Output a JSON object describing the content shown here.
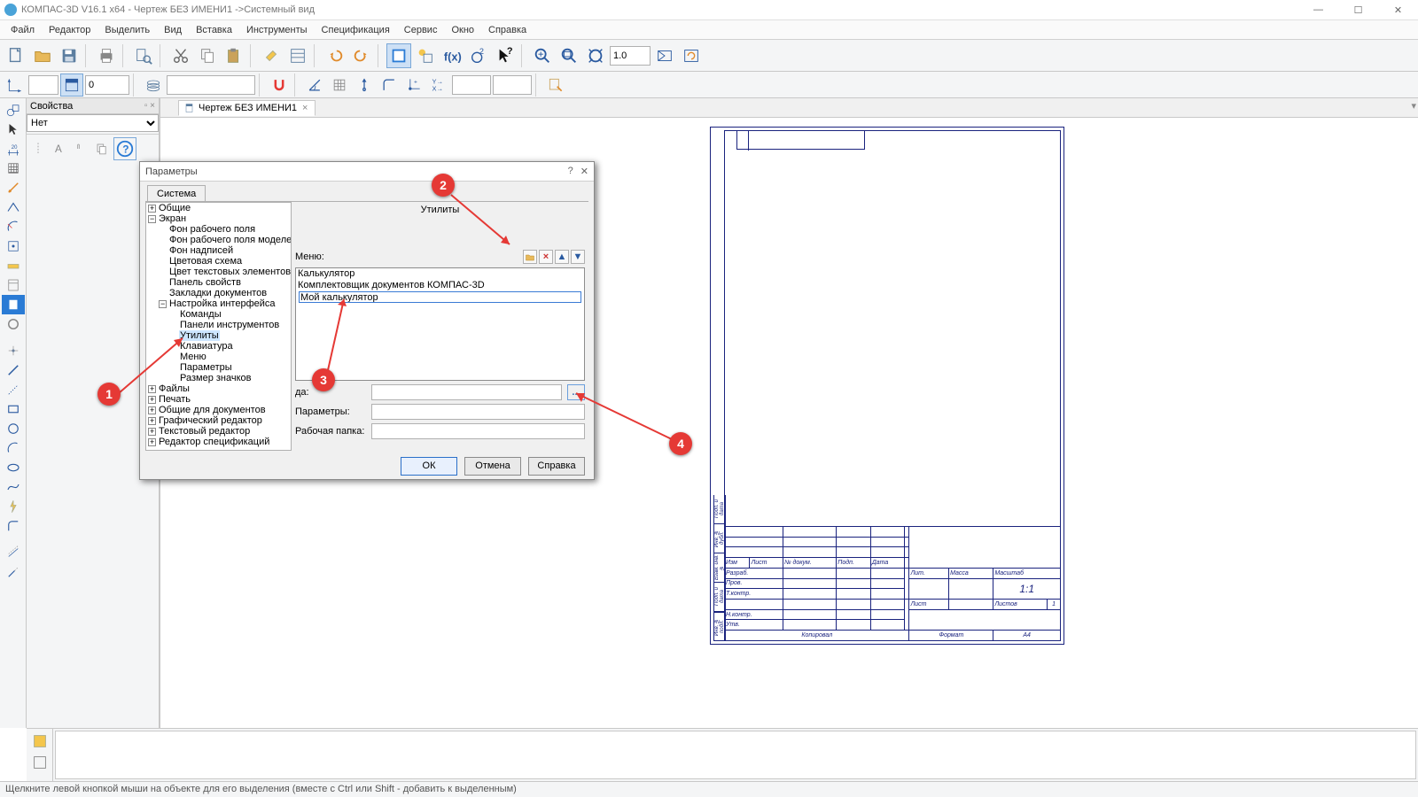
{
  "app": {
    "title": "КОМПАС-3D V16.1 x64 - Чертеж БЕЗ ИМЕНИ1 ->Системный вид",
    "win_min": "—",
    "win_max": "☐",
    "win_close": "✕"
  },
  "menu": {
    "items": [
      "Файл",
      "Редактор",
      "Выделить",
      "Вид",
      "Вставка",
      "Инструменты",
      "Спецификация",
      "Сервис",
      "Окно",
      "Справка"
    ]
  },
  "props": {
    "title": "Свойства",
    "pins": "▫ ×",
    "combo": "Нет"
  },
  "doc_tab": {
    "label": "Чертеж БЕЗ ИМЕНИ1",
    "close": "×",
    "extra": "▾"
  },
  "status": {
    "text": "Щелкните левой кнопкой мыши на объекте для его выделения (вместе с Ctrl или Shift - добавить к выделенным)"
  },
  "inputs": {
    "layer": "0",
    "zoom": "1.0"
  },
  "dialog": {
    "title": "Параметры",
    "help": "?",
    "close": "✕",
    "tab": "Система",
    "rpane_title": "Утилиты",
    "menu_label": "Меню:",
    "list": {
      "items": [
        "Калькулятор",
        "Комплектовщик документов КОМПАС-3D"
      ],
      "editing_value": "Мой калькулятор"
    },
    "form": {
      "cmd_label": "да:",
      "params_label": "Параметры:",
      "dir_label": "Рабочая папка:",
      "browse": "..."
    },
    "buttons": {
      "ok": "ОК",
      "cancel": "Отмена",
      "help": "Справка"
    },
    "tree": {
      "n0": "Общие",
      "n1": "Экран",
      "n1_0": "Фон рабочего поля",
      "n1_1": "Фон рабочего поля моделей",
      "n1_2": "Фон надписей",
      "n1_3": "Цветовая схема",
      "n1_4": "Цвет текстовых элементов",
      "n1_5": "Панель свойств",
      "n1_6": "Закладки документов",
      "n1_7": "Настройка интерфейса",
      "n1_7_0": "Команды",
      "n1_7_1": "Панели инструментов",
      "n1_7_2": "Утилиты",
      "n1_7_3": "Клавиатура",
      "n1_7_4": "Меню",
      "n1_7_5": "Параметры",
      "n1_7_6": "Размер значков",
      "n2": "Файлы",
      "n3": "Печать",
      "n4": "Общие для документов",
      "n5": "Графический редактор",
      "n6": "Текстовый редактор",
      "n7": "Редактор спецификаций"
    }
  },
  "markers": {
    "m1": "1",
    "m2": "2",
    "m3": "3",
    "m4": "4"
  },
  "tblock": {
    "r1c1": "Изм",
    "r1c2": "Лист",
    "r1c3": "№ докум.",
    "r1c4": "Подп.",
    "r1c5": "Дата",
    "rA": "Разраб.",
    "rB": "Пров.",
    "rC": "Т.контр.",
    "rD": "Н.контр.",
    "rE": "Утв.",
    "hL": "Лит.",
    "hM": "Масса",
    "hS": "Масштаб",
    "scale": "1:1",
    "hList": "Лист",
    "hLists": "Листов",
    "one": "1",
    "copy": "Копировал",
    "fmt": "Формат",
    "a4": "A4",
    "s1": "Инв. № подл.",
    "s2": "Подп. и дата",
    "s3": "Взам. инв. №",
    "s4": "Инв. № дубл.",
    "s5": "Подп. и дата"
  }
}
